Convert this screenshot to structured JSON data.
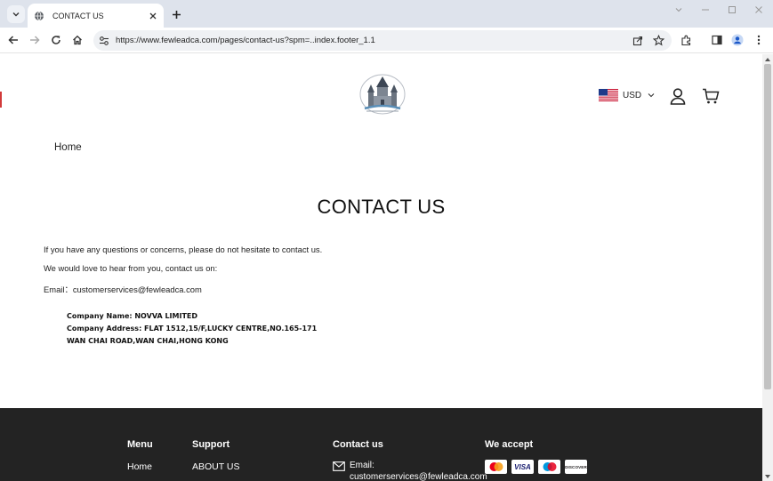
{
  "browser": {
    "tab": {
      "title": "CONTACT US"
    },
    "address_bar": {
      "url": "https://www.fewleadca.com/pages/contact-us?spm=..index.footer_1.1"
    }
  },
  "header": {
    "currency": {
      "code": "USD",
      "flag": "us-flag-icon"
    },
    "icons": [
      "account-icon",
      "cart-icon"
    ]
  },
  "breadcrumb": {
    "home": "Home"
  },
  "page": {
    "title": "CONTACT US",
    "intro": "If you have any questions or concerns, please do not hesitate to contact us.",
    "hear": "We would love to hear from you, contact us on:",
    "email_line": "Email：customerservices@fewleadca.com",
    "company_name": "Company Name: NOVVA LIMITED",
    "company_address_1": "Company Address: FLAT 1512,15/F,LUCKY CENTRE,NO.165-171",
    "company_address_2": "WAN CHAI ROAD,WAN CHAI,HONG KONG"
  },
  "footer": {
    "menu": {
      "heading": "Menu",
      "items": [
        "Home"
      ]
    },
    "support": {
      "heading": "Support",
      "items": [
        "ABOUT US"
      ]
    },
    "contact": {
      "heading": "Contact us",
      "email_label": "Email:",
      "email_value": "customerservices@fewleadca.com"
    },
    "payments": {
      "heading": "We accept",
      "cards": [
        "mastercard",
        "visa",
        "maestro",
        "discover"
      ],
      "visa_label": "VISA",
      "discover_label": "DISCOVER"
    }
  }
}
